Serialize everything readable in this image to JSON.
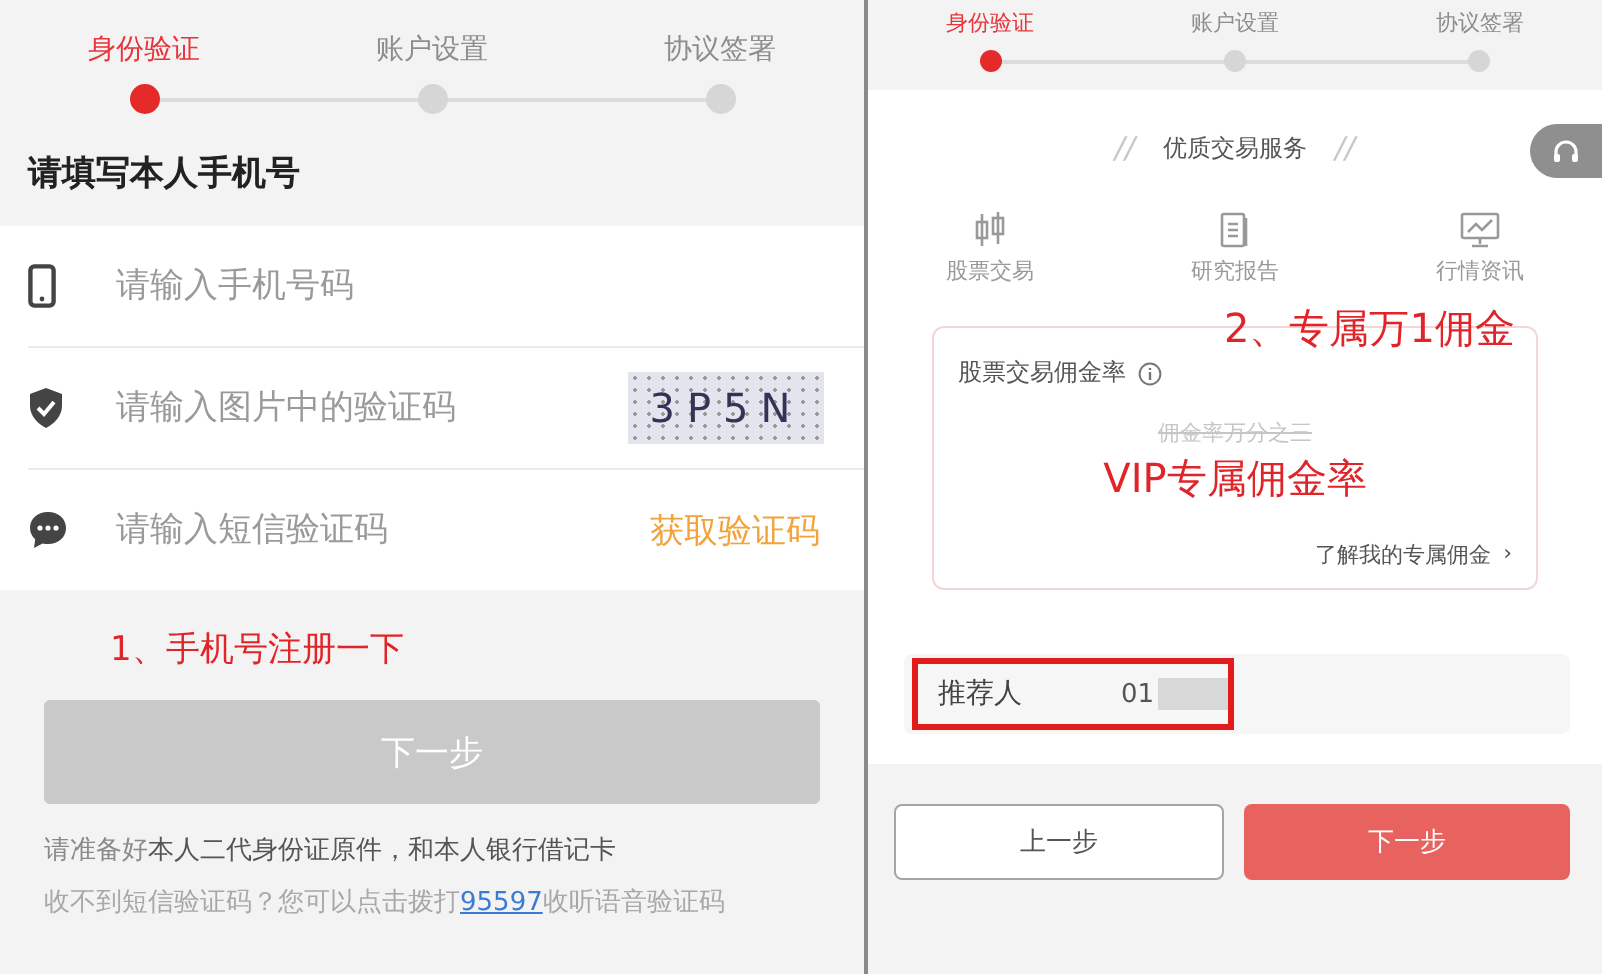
{
  "left": {
    "steps": [
      {
        "label": "身份验证",
        "selected": true
      },
      {
        "label": "账户设置",
        "selected": false
      },
      {
        "label": "协议签署",
        "selected": false
      }
    ],
    "title": "请填写本人手机号",
    "fields": [
      {
        "kind": "phone",
        "placeholder": "请输入手机号码"
      },
      {
        "kind": "captcha",
        "placeholder": "请输入图片中的验证码",
        "captcha": "3P5N"
      },
      {
        "kind": "sms",
        "placeholder": "请输入短信验证码",
        "action": "获取验证码"
      }
    ],
    "annotation": "1、手机号注册一下",
    "next_button": {
      "label": "下一步",
      "disabled": true
    },
    "hint": "请准备好**本人二代身份证原件，和本人银行借记卡**",
    "help": {
      "before": "收不到短信验证码？您可以点击拨打",
      "link": "95597",
      "after": "收听语音验证码"
    }
  },
  "right": {
    "steps": [
      {
        "label": "身份验证",
        "selected": true
      },
      {
        "label": "账户设置",
        "selected": false
      },
      {
        "label": "协议签署",
        "selected": false
      }
    ],
    "service_title": "优质交易服务",
    "service_marks": [
      "//",
      "//"
    ],
    "services": [
      {
        "kind": "candles",
        "label": "股票交易"
      },
      {
        "kind": "report",
        "label": "研究报告"
      },
      {
        "kind": "monitor",
        "label": "行情资讯"
      }
    ],
    "annotation": "2、专属万1佣金",
    "card": {
      "title": "股票交易佣金率",
      "old_rate": "佣金率万分之三",
      "old_rate_struck": true,
      "vip": "VIP专属佣金率",
      "link": "了解我的专属佣金",
      "link_arrow": "›"
    },
    "referrer": {
      "label": "推荐人",
      "value": "01",
      "highlighted": true
    },
    "buttons": [
      {
        "kind": "secondary",
        "label": "上一步"
      },
      {
        "kind": "primary",
        "label": "下一步"
      }
    ]
  }
}
